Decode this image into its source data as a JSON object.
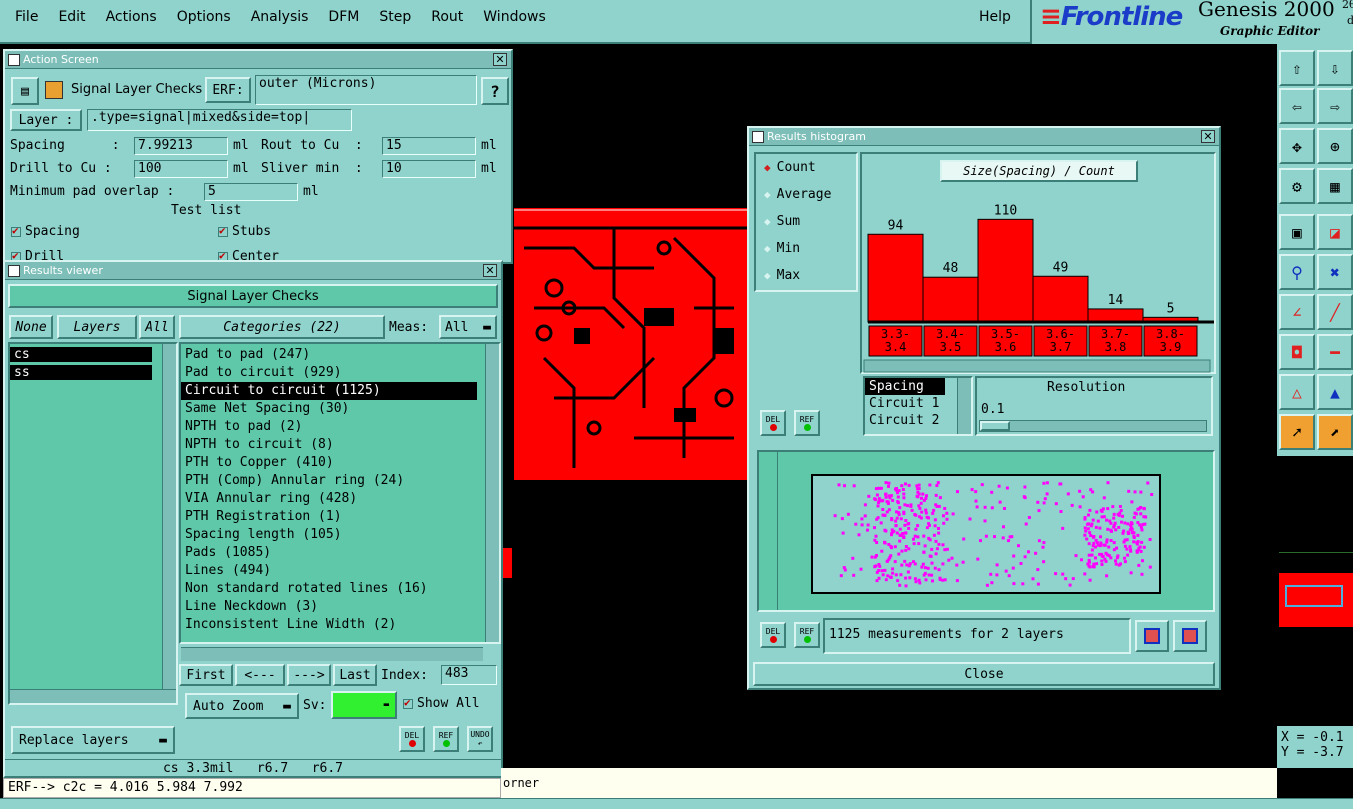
{
  "menubar": {
    "items": [
      "File",
      "Edit",
      "Actions",
      "Options",
      "Analysis",
      "DFM",
      "Step",
      "Rout",
      "Windows"
    ],
    "help": "Help"
  },
  "brand": {
    "logo": "Frontline",
    "product": "Genesis 2000",
    "version_fragment": "2θ",
    "subtitle": "Graphic Editor",
    "small": "d"
  },
  "action_screen": {
    "title": "Action Screen",
    "header": "Signal Layer Checks",
    "erf_label": "ERF:",
    "erf_value": "outer (Microns)",
    "help": "?",
    "layer_label": "Layer :",
    "layer_value": ".type=signal|mixed&side=top|",
    "spacing_label": "Spacing      :",
    "spacing_value": "7.99213",
    "spacing_unit": "ml",
    "rout_label": "Rout to Cu  :",
    "rout_value": "15",
    "rout_unit": "ml",
    "drill_label": "Drill to Cu :",
    "drill_value": "100",
    "drill_unit": "ml",
    "sliver_label": "Sliver min  :",
    "sliver_value": "10",
    "sliver_unit": "ml",
    "pad_overlap_label": "Minimum pad overlap :",
    "pad_overlap_value": "5",
    "pad_overlap_unit": "ml",
    "test_list": "Test list",
    "tests": [
      "Spacing",
      "Stubs",
      "Drill",
      "Center"
    ]
  },
  "results_viewer": {
    "title": "Results viewer",
    "header": "Signal Layer Checks",
    "none": "None",
    "layers": "Layers",
    "all": "All",
    "layer_items": [
      "cs",
      "ss"
    ],
    "categories_label": "Categories (22)",
    "meas_label": "Meas:",
    "meas_value": "All",
    "categories": [
      "Pad to pad (247)",
      "Pad to circuit (929)",
      "Circuit to circuit (1125)",
      "Same Net Spacing (30)",
      "NPTH to pad (2)",
      "NPTH to circuit (8)",
      "PTH to Copper (410)",
      "PTH (Comp) Annular ring (24)",
      "VIA Annular ring (428)",
      "PTH Registration (1)",
      "Spacing length (105)",
      "Pads (1085)",
      "Lines (494)",
      "Non standard rotated lines (16)",
      "Line Neckdown (3)",
      "Inconsistent Line Width (2)"
    ],
    "first": "First",
    "prev": "<---",
    "next": "--->",
    "last": "Last",
    "index_label": "Index:",
    "index_value": "483",
    "auto_zoom": "Auto Zoom",
    "sv_label": "Sv:",
    "show_all": "Show All",
    "replace_layers": "Replace layers",
    "del": "DEL",
    "ref": "REF",
    "undo": "UNDO"
  },
  "status": {
    "line1": "cs 3.3mil   r6.7   r6.7",
    "line2": "ERF--> c2c = 4.016 5.984 7.992",
    "corner": "orner"
  },
  "histogram": {
    "title": "Results histogram",
    "modes": [
      "Count",
      "Average",
      "Sum",
      "Min",
      "Max"
    ],
    "selected_mode": "Count",
    "chart_title": "Size(Spacing) / Count",
    "del": "DEL",
    "ref": "REF",
    "fields": [
      "Spacing",
      "Circuit 1",
      "Circuit 2"
    ],
    "resolution_label": "Resolution",
    "resolution_value": "0.1",
    "measurements": "1125 measurements for 2 layers",
    "close": "Close"
  },
  "chart_data": {
    "type": "bar",
    "title": "Size(Spacing) / Count",
    "categories": [
      "3.3-3.4",
      "3.4-3.5",
      "3.5-3.6",
      "3.6-3.7",
      "3.7-3.8",
      "3.8-3.9"
    ],
    "values": [
      94,
      48,
      110,
      49,
      14,
      5
    ],
    "ylim": [
      0,
      120
    ]
  },
  "coords": {
    "x": "X = -0.1",
    "y": "Y = -3.7"
  },
  "colors": {
    "panel": "#8fd3cc",
    "accent_red": "#ff0000",
    "panel_dark": "#3b7f78",
    "highlight": "#ff00ff"
  }
}
